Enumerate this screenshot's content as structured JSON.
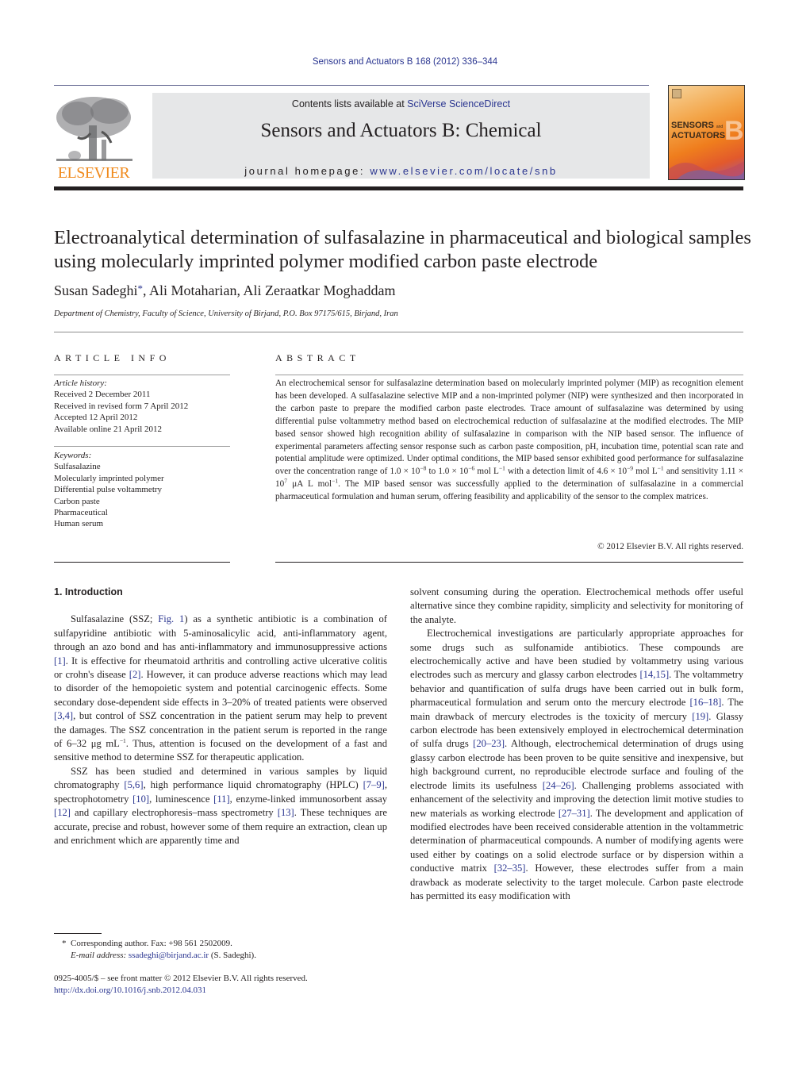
{
  "header": {
    "citation": "Sensors and Actuators B 168 (2012) 336–344",
    "contents_prefix": "Contents lists available at ",
    "contents_link": "SciVerse ScienceDirect",
    "journal_title": "Sensors and Actuators B: Chemical",
    "homepage_prefix": "journal homepage: ",
    "homepage_url": "www.elsevier.com/locate/snb",
    "publisher_logo_text": "ELSEVIER",
    "cover": {
      "word1": "SENSORS",
      "and": "and",
      "word2": "ACTUATORS",
      "letter": "B"
    },
    "colors": {
      "link": "#2a3590",
      "elsevier_orange": "#f08a1c",
      "banner_bg": "#e6e7e8"
    }
  },
  "article": {
    "title": "Electroanalytical determination of sulfasalazine in pharmaceutical and biological samples using molecularly imprinted polymer modified carbon paste electrode",
    "authors": [
      {
        "name": "Susan Sadeghi",
        "mark": "*"
      },
      {
        "name": "Ali Motaharian",
        "mark": ""
      },
      {
        "name": "Ali Zeraatkar Moghaddam",
        "mark": ""
      }
    ],
    "affiliation": "Department of Chemistry, Faculty of Science, University of Birjand, P.O. Box 97175/615, Birjand, Iran"
  },
  "article_info": {
    "label": "ARTICLE INFO",
    "history_heading": "Article history:",
    "history": [
      "Received 2 December 2011",
      "Received in revised form 7 April 2012",
      "Accepted 12 April 2012",
      "Available online 21 April 2012"
    ],
    "keywords_heading": "Keywords:",
    "keywords": [
      "Sulfasalazine",
      "Molecularly imprinted polymer",
      "Differential pulse voltammetry",
      "Carbon paste",
      "Pharmaceutical",
      "Human serum"
    ]
  },
  "abstract": {
    "label": "ABSTRACT",
    "text_1": "An electrochemical sensor for sulfasalazine determination based on molecularly imprinted polymer (MIP) as recognition element has been developed. A sulfasalazine selective MIP and a non-imprinted polymer (NIP) were synthesized and then incorporated in the carbon paste to prepare the modified carbon paste electrodes. Trace amount of sulfasalazine was determined by using differential pulse voltammetry method based on electrochemical reduction of sulfasalazine at the modified electrodes. The MIP based sensor showed high recognition ability of sulfasalazine in comparison with the NIP based sensor. The influence of experimental parameters affecting sensor response such as carbon paste composition, pH, incubation time, potential scan rate and potential amplitude were optimized. Under optimal conditions, the MIP based sensor exhibited good performance for sulfasalazine over the concentration range of 1.0 × 10",
    "exp_1": "−8",
    "text_2": " to 1.0 × 10",
    "exp_2": "−6",
    "text_3": " mol L",
    "exp_3": "−1",
    "text_4": " with a detection limit of 4.6 × 10",
    "exp_4": "−9",
    "text_5": " mol L",
    "exp_5": "−1",
    "text_6": " and sensitivity 1.11 × 10",
    "exp_6": "7",
    "text_7": " μA L mol",
    "exp_7": "−1",
    "text_8": ". The MIP based sensor was successfully applied to the determination of sulfasalazine in a commercial pharmaceutical formulation and human serum, offering feasibility and applicability of the sensor to the complex matrices.",
    "copyright": "© 2012 Elsevier B.V. All rights reserved."
  },
  "body": {
    "section_heading": "1.  Introduction",
    "p1": {
      "a": "Sulfasalazine (SSZ; ",
      "fig": "Fig. 1",
      "b": ") as a synthetic antibiotic is a combination of sulfapyridine antibiotic with 5-aminosalicylic acid, anti-inflammatory agent, through an azo bond and has anti-inflammatory and immunosuppressive actions ",
      "r1": "[1]",
      "c": ". It is effective for rheumatoid arthritis and controlling active ulcerative colitis or crohn's disease ",
      "r2": "[2]",
      "d": ". However, it can produce adverse reactions which may lead to disorder of the hemopoietic system and potential carcinogenic effects. Some secondary dose-dependent side effects in 3–20% of treated patients were observed ",
      "r3": "[3,4]",
      "e": ", but control of SSZ concentration in the patient serum may help to prevent the damages. The SSZ concentration in the patient serum is reported in the range of 6–32 μg mL",
      "exp": "−1",
      "f": ". Thus, attention is focused on the development of a fast and sensitive method to determine SSZ for therapeutic application."
    },
    "p2": {
      "a": "SSZ has been studied and determined in various samples by liquid chromatography ",
      "r1": "[5,6]",
      "b": ", high performance liquid chromatography (HPLC) ",
      "r2": "[7–9]",
      "c": ", spectrophotometry ",
      "r3": "[10]",
      "d": ", luminescence ",
      "r4": "[11]",
      "e": ", enzyme-linked immunosorbent assay ",
      "r5": "[12]",
      "f": " and capillary electrophoresis–mass spectrometry ",
      "r6": "[13]",
      "g": ". These techniques are accurate, precise and robust, however some of them require an extraction, clean up and enrichment which are apparently time and"
    },
    "p3": "solvent consuming during the operation. Electrochemical methods offer useful alternative since they combine rapidity, simplicity and selectivity for monitoring of the analyte.",
    "p4": {
      "a": "Electrochemical investigations are particularly appropriate approaches for some drugs such as sulfonamide antibiotics. These compounds are electrochemically active and have been studied by voltammetry using various electrodes such as mercury and glassy carbon electrodes ",
      "r1": "[14,15]",
      "b": ". The voltammetry behavior and quantification of sulfa drugs have been carried out in bulk form, pharmaceutical formulation and serum onto the mercury electrode ",
      "r2": "[16–18]",
      "c": ". The main drawback of mercury electrodes is the toxicity of mercury ",
      "r3": "[19]",
      "d": ". Glassy carbon electrode has been extensively employed in electrochemical determination of sulfa drugs ",
      "r4": "[20–23]",
      "e": ". Although, electrochemical determination of drugs using glassy carbon electrode has been proven to be quite sensitive and inexpensive, but high background current, no reproducible electrode surface and fouling of the electrode limits its usefulness ",
      "r5": "[24–26]",
      "f": ". Challenging problems associated with enhancement of the selectivity and improving the detection limit motive studies to new materials as working electrode ",
      "r6": "[27–31]",
      "g": ". The development and application of modified electrodes have been received considerable attention in the voltammetric determination of pharmaceutical compounds. A number of modifying agents were used either by coatings on a solid electrode surface or by dispersion within a conductive matrix ",
      "r7": "[32–35]",
      "h": ". However, these electrodes suffer from a main drawback as moderate selectivity to the target molecule. Carbon paste electrode has permitted its easy modification with"
    }
  },
  "footnotes": {
    "mark": "*",
    "corresponding": "Corresponding author. Fax: +98 561 2502009.",
    "email_label": "E-mail address:",
    "email": "ssadeghi@birjand.ac.ir",
    "email_suffix": " (S. Sadeghi).",
    "front_matter": "0925-4005/$ – see front matter © 2012 Elsevier B.V. All rights reserved.",
    "doi": "http://dx.doi.org/10.1016/j.snb.2012.04.031"
  }
}
